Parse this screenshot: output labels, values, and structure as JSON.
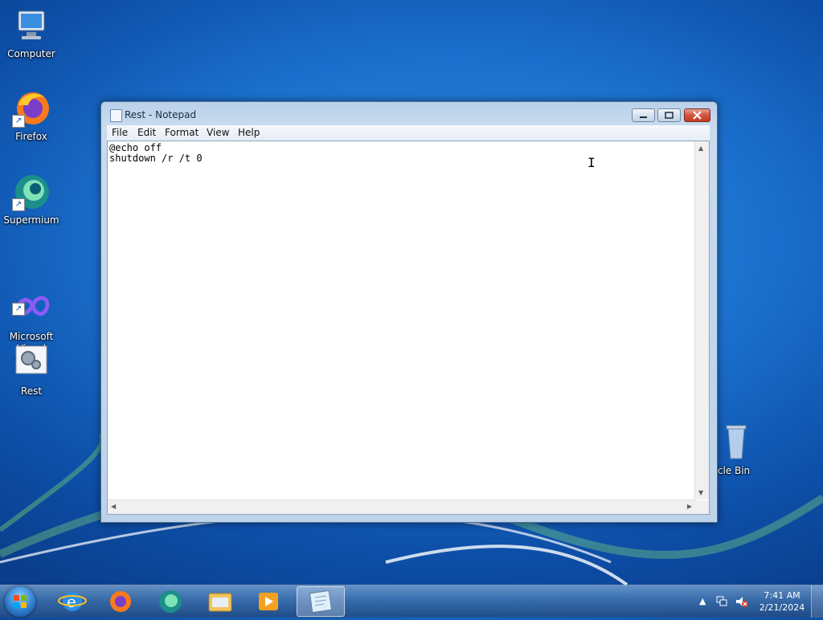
{
  "desktop": {
    "icons": [
      {
        "label": "Computer",
        "icon": "computer-icon"
      },
      {
        "label": "Firefox",
        "icon": "firefox-icon"
      },
      {
        "label": "Supermium",
        "icon": "supermium-icon"
      },
      {
        "label": "Microsoft\nVisual Stud...",
        "icon": "visual-studio-icon"
      },
      {
        "label": "Rest",
        "icon": "batch-file-icon"
      },
      {
        "label": "cle Bin",
        "icon": "recycle-bin-icon"
      }
    ]
  },
  "window": {
    "title": "Rest - Notepad",
    "menu": [
      "File",
      "Edit",
      "Format",
      "View",
      "Help"
    ],
    "content": "@echo off\nshutdown /r /t 0"
  },
  "taskbar": {
    "pinned": [
      "internet-explorer-icon",
      "firefox-icon",
      "supermium-icon",
      "file-explorer-icon",
      "media-player-icon",
      "notepad-icon"
    ],
    "clock": {
      "time": "7:41 AM",
      "date": "2/21/2024"
    }
  },
  "colors": {
    "accent": "#1a6fcc",
    "close": "#c23a22"
  }
}
